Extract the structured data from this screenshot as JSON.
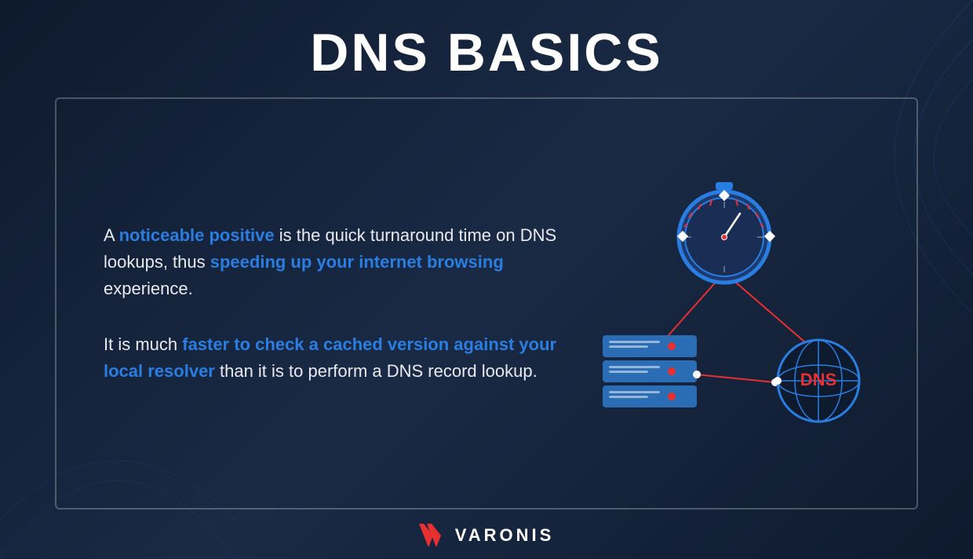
{
  "page": {
    "title": "DNS BASICS",
    "background_color": "#0e1a2e"
  },
  "content": {
    "paragraph1": {
      "prefix": "A ",
      "highlight1": "noticeable positive",
      "middle": " is the quick turnaround time on DNS lookups, thus ",
      "highlight2": "speeding up your internet browsing",
      "suffix": " experience."
    },
    "paragraph2": {
      "prefix": "It is much ",
      "highlight": "faster to check a cached version against your local resolver",
      "suffix": " than it is to perform a DNS record lookup."
    }
  },
  "illustration": {
    "dns_label": "DNS"
  },
  "footer": {
    "brand_name": "VARONIS"
  }
}
